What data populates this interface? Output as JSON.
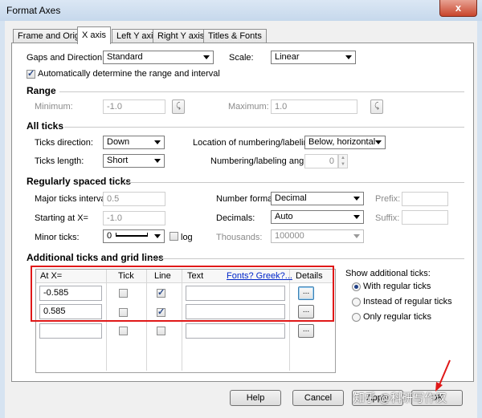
{
  "window": {
    "title": "Format Axes",
    "close_glyph": "x"
  },
  "tabs": [
    {
      "label": "Frame and Origin"
    },
    {
      "label": "X axis"
    },
    {
      "label": "Left Y axis"
    },
    {
      "label": "Right Y axis"
    },
    {
      "label": "Titles & Fonts"
    }
  ],
  "gaps": {
    "label": "Gaps and Direction:",
    "value": "Standard"
  },
  "scale": {
    "label": "Scale:",
    "value": "Linear"
  },
  "auto_range": {
    "label": "Automatically determine the range and interval",
    "checked": true
  },
  "range": {
    "heading": "Range",
    "minimum_label": "Minimum:",
    "minimum_value": "-1.0",
    "maximum_label": "Maximum:",
    "maximum_value": "1.0"
  },
  "all_ticks": {
    "heading": "All ticks",
    "direction_label": "Ticks direction:",
    "direction_value": "Down",
    "length_label": "Ticks length:",
    "length_value": "Short",
    "location_label": "Location of numbering/labeling:",
    "location_value": "Below, horizontal",
    "angle_label": "Numbering/labeling angle:",
    "angle_value": "0"
  },
  "regular": {
    "heading": "Regularly spaced ticks",
    "major_label": "Major ticks interval:",
    "major_value": "0.5",
    "start_label": "Starting at X=",
    "start_value": "-1.0",
    "minor_label": "Minor ticks:",
    "minor_value": "0",
    "log_label": "log",
    "format_label": "Number format:",
    "format_value": "Decimal",
    "decimals_label": "Decimals:",
    "decimals_value": "Auto",
    "thousands_label": "Thousands:",
    "thousands_value": "100000",
    "prefix_label": "Prefix:",
    "suffix_label": "Suffix:"
  },
  "additional": {
    "heading": "Additional ticks and grid lines",
    "columns": {
      "at_x": "At X=",
      "tick": "Tick",
      "line": "Line",
      "text": "Text",
      "fonts": "Fonts? Greek?...",
      "details": "Details"
    },
    "rows": [
      {
        "at_x": "-0.585",
        "tick": false,
        "line": true,
        "details": "..."
      },
      {
        "at_x": "0.585",
        "tick": false,
        "line": true,
        "details": "..."
      },
      {
        "at_x": "",
        "tick": false,
        "line": false,
        "details": "..."
      }
    ],
    "show_label": "Show additional ticks:",
    "options": [
      {
        "label": "With regular ticks",
        "selected": true
      },
      {
        "label": "Instead of regular ticks",
        "selected": false
      },
      {
        "label": "Only regular ticks",
        "selected": false
      }
    ]
  },
  "buttons": {
    "help": "Help",
    "cancel": "Cancel",
    "apply": "Apply",
    "ok": "OK"
  },
  "watermark": "知乎 @科研写作汉"
}
